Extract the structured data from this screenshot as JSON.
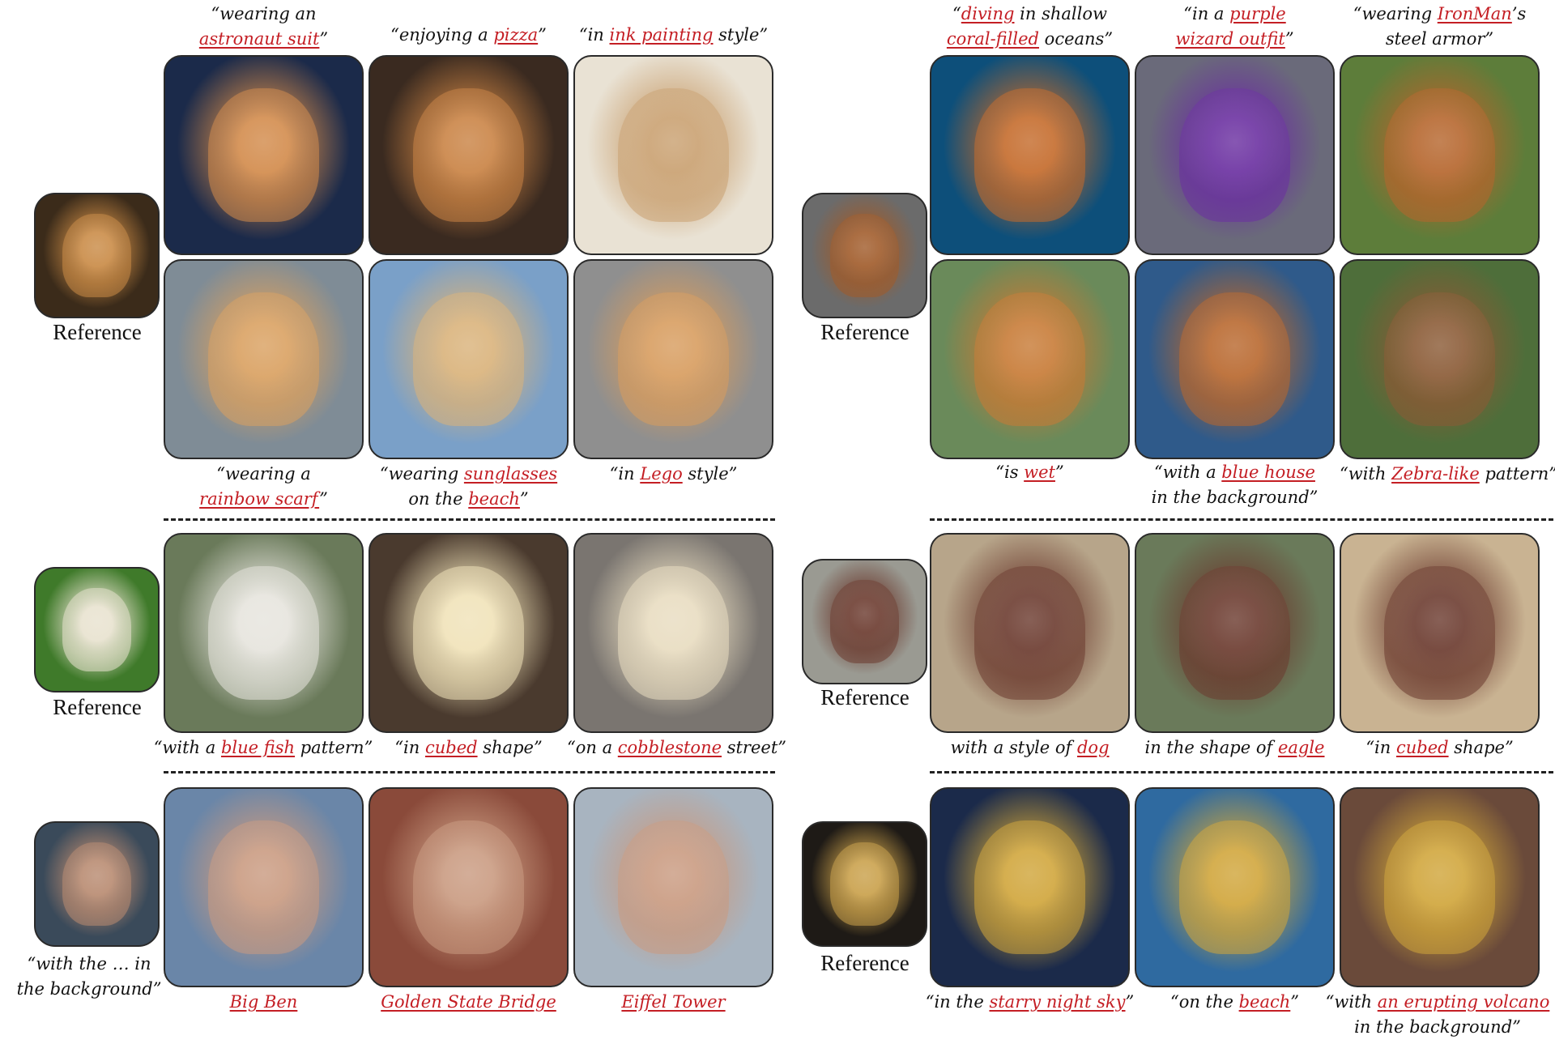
{
  "reference_label": "Reference",
  "colors": {
    "highlight": "#c41e24",
    "text": "#111111",
    "border": "#2a2a2a"
  },
  "groups": [
    {
      "id": "cat",
      "reference": {
        "subject": "cat",
        "colors": [
          "#3b2b1a",
          "#c98a45"
        ]
      },
      "images": [
        {
          "subject": "cat",
          "colors": [
            "#1b2a4a",
            "#d28a4a"
          ],
          "caption": [
            {
              "t": "“wearing an "
            },
            {
              "br": true
            },
            {
              "t": "astronaut suit",
              "h": true
            },
            {
              "t": "”"
            }
          ]
        },
        {
          "subject": "cat",
          "colors": [
            "#3a2a20",
            "#c98243"
          ],
          "caption": [
            {
              "t": "“enjoying a "
            },
            {
              "t": "pizza",
              "h": true
            },
            {
              "t": "”"
            }
          ]
        },
        {
          "subject": "cat",
          "colors": [
            "#e9e2d4",
            "#c9a070"
          ],
          "caption": [
            {
              "t": "“in "
            },
            {
              "t": "ink painting",
              "h": true
            },
            {
              "t": " style”"
            }
          ]
        },
        {
          "subject": "cat",
          "colors": [
            "#7f8c96",
            "#d9a060"
          ],
          "caption": [
            {
              "t": "“wearing a "
            },
            {
              "br": true
            },
            {
              "t": "rainbow scarf",
              "h": true
            },
            {
              "t": "”"
            }
          ]
        },
        {
          "subject": "cat",
          "colors": [
            "#7aa0c8",
            "#d9b27a"
          ],
          "caption": [
            {
              "t": "“wearing "
            },
            {
              "t": "sunglasses",
              "h": true
            },
            {
              "br": true
            },
            {
              "t": "on the "
            },
            {
              "t": "beach",
              "h": true
            },
            {
              "t": "”"
            }
          ]
        },
        {
          "subject": "cat",
          "colors": [
            "#8f8f8f",
            "#d79c5e"
          ],
          "caption": [
            {
              "t": "“in "
            },
            {
              "t": "Lego",
              "h": true
            },
            {
              "t": " style”"
            }
          ]
        }
      ]
    },
    {
      "id": "dog",
      "reference": {
        "subject": "dog",
        "colors": [
          "#6b6b6b",
          "#a05b2a"
        ]
      },
      "images": [
        {
          "subject": "dog",
          "colors": [
            "#0d4f7a",
            "#c46a2a"
          ],
          "caption": [
            {
              "t": "“"
            },
            {
              "t": "diving",
              "h": true
            },
            {
              "t": " in shallow"
            },
            {
              "br": true
            },
            {
              "t": "coral-filled",
              "h": true
            },
            {
              "t": " oceans”"
            }
          ]
        },
        {
          "subject": "dog",
          "colors": [
            "#6a6a7a",
            "#6a2fa0"
          ],
          "caption": [
            {
              "t": "“in a "
            },
            {
              "t": "purple",
              "h": true
            },
            {
              "br": true
            },
            {
              "t": "wizard outfit",
              "h": true
            },
            {
              "t": "”"
            }
          ]
        },
        {
          "subject": "dog",
          "colors": [
            "#5d7d3a",
            "#b5652c"
          ],
          "caption": [
            {
              "t": "“wearing "
            },
            {
              "t": "IronMan",
              "h": true
            },
            {
              "t": "’s"
            },
            {
              "br": true
            },
            {
              "t": "steel armor”"
            }
          ]
        },
        {
          "subject": "dog",
          "colors": [
            "#6a8a5a",
            "#c77a35"
          ],
          "caption": [
            {
              "t": "“is "
            },
            {
              "t": "wet",
              "h": true
            },
            {
              "t": "”"
            }
          ]
        },
        {
          "subject": "dog",
          "colors": [
            "#2f5a8a",
            "#b8672d"
          ],
          "caption": [
            {
              "t": "“with a "
            },
            {
              "t": "blue house",
              "h": true
            },
            {
              "br": true
            },
            {
              "t": "in the background”"
            }
          ]
        },
        {
          "subject": "dog",
          "colors": [
            "#4e6e3a",
            "#8a5a35"
          ],
          "caption": [
            {
              "t": "“with "
            },
            {
              "t": "Zebra-like",
              "h": true
            },
            {
              "t": " pattern”"
            }
          ]
        }
      ]
    },
    {
      "id": "candle",
      "reference": {
        "subject": "candle",
        "colors": [
          "#3f7a2a",
          "#e8e2cf"
        ]
      },
      "images": [
        {
          "subject": "candle",
          "colors": [
            "#6a7a5a",
            "#e6e4dd"
          ],
          "caption": [
            {
              "t": "“with a "
            },
            {
              "t": "blue fish",
              "h": true
            },
            {
              "t": " pattern”"
            }
          ]
        },
        {
          "subject": "candle",
          "colors": [
            "#4a3a2e",
            "#f0e2b8"
          ],
          "caption": [
            {
              "t": "“in "
            },
            {
              "t": "cubed",
              "h": true
            },
            {
              "t": " shape”"
            }
          ]
        },
        {
          "subject": "candle",
          "colors": [
            "#7a7570",
            "#e8dcc0"
          ],
          "caption": [
            {
              "t": "“on a "
            },
            {
              "t": "cobblestone",
              "h": true
            },
            {
              "t": " street”"
            }
          ]
        }
      ]
    },
    {
      "id": "toy",
      "reference": {
        "subject": "toy",
        "colors": [
          "#9a9a92",
          "#6b3a2e"
        ]
      },
      "images": [
        {
          "subject": "toy",
          "colors": [
            "#b7a58a",
            "#6b3a2e"
          ],
          "caption": [
            {
              "t": "with a style of "
            },
            {
              "t": "dog",
              "h": true
            }
          ]
        },
        {
          "subject": "toy",
          "colors": [
            "#6a7a5a",
            "#6b3a2e"
          ],
          "caption": [
            {
              "t": "in the shape of "
            },
            {
              "t": "eagle",
              "h": true
            }
          ]
        },
        {
          "subject": "toy",
          "colors": [
            "#c9b392",
            "#6b3a2e"
          ],
          "caption": [
            {
              "t": "“in "
            },
            {
              "t": "cubed",
              "h": true
            },
            {
              "t": " shape”"
            }
          ]
        }
      ]
    },
    {
      "id": "man",
      "reference": {
        "subject": "person",
        "colors": [
          "#3a4a5a",
          "#b88a70"
        ]
      },
      "caption_prefix": [
        {
          "t": "“with the … in"
        },
        {
          "br": true
        },
        {
          "t": "the background”"
        }
      ],
      "images": [
        {
          "subject": "person",
          "colors": [
            "#6a86a8",
            "#c99a80"
          ],
          "caption": [
            {
              "t": "Big Ben",
              "h": true
            }
          ]
        },
        {
          "subject": "person",
          "colors": [
            "#8a4a3a",
            "#c99a80"
          ],
          "caption": [
            {
              "t": "Golden State Bridge",
              "h": true
            }
          ]
        },
        {
          "subject": "person",
          "colors": [
            "#a8b4c0",
            "#c99a80"
          ],
          "caption": [
            {
              "t": "Eiffel Tower",
              "h": true
            }
          ]
        }
      ]
    },
    {
      "id": "girl",
      "reference": {
        "subject": "painting",
        "colors": [
          "#1e1a16",
          "#c9a04a"
        ]
      },
      "images": [
        {
          "subject": "painting",
          "colors": [
            "#1b2a4a",
            "#d0a53a"
          ],
          "caption": [
            {
              "t": "“in the "
            },
            {
              "t": "starry night sky",
              "h": true
            },
            {
              "t": "”"
            }
          ]
        },
        {
          "subject": "painting",
          "colors": [
            "#2f6aa0",
            "#d0a53a"
          ],
          "caption": [
            {
              "t": "“on the "
            },
            {
              "t": "beach",
              "h": true
            },
            {
              "t": "”"
            }
          ]
        },
        {
          "subject": "painting",
          "colors": [
            "#6a4a3a",
            "#d0a53a"
          ],
          "caption": [
            {
              "t": "“with "
            },
            {
              "t": "an erupting volcano",
              "h": true
            },
            {
              "br": true
            },
            {
              "t": "in the background”"
            }
          ]
        }
      ]
    }
  ]
}
